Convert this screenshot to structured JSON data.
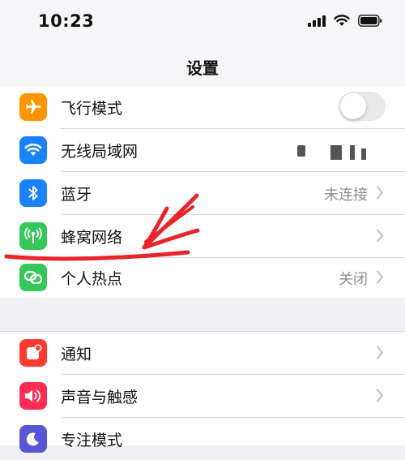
{
  "status_bar": {
    "time": "10:23",
    "icons": [
      "cellular-signal-icon",
      "wifi-icon",
      "battery-icon"
    ]
  },
  "nav": {
    "title": "设置"
  },
  "colors": {
    "airplane": "#ff9500",
    "wifi": "#1a82fb",
    "bluetooth": "#1a82fb",
    "cellular": "#34c759",
    "hotspot": "#34c759",
    "notifications": "#ff3b30",
    "sounds": "#ff2d55",
    "focus": "#5856d6",
    "annotation": "#e8252a"
  },
  "settings_group_1": [
    {
      "key": "airplane",
      "label": "飞行模式",
      "icon": "airplane-icon",
      "control": "toggle",
      "toggle_on": false
    },
    {
      "key": "wifi",
      "label": "无线局域网",
      "icon": "wifi-icon",
      "control": "value-redacted"
    },
    {
      "key": "bluetooth",
      "label": "蓝牙",
      "icon": "bluetooth-icon",
      "value": "未连接",
      "control": "chevron"
    },
    {
      "key": "cellular",
      "label": "蜂窝网络",
      "icon": "antenna-icon",
      "control": "chevron"
    },
    {
      "key": "hotspot",
      "label": "个人热点",
      "icon": "hotspot-link-icon",
      "value": "关闭",
      "control": "chevron"
    }
  ],
  "settings_group_2": [
    {
      "key": "notifications",
      "label": "通知",
      "icon": "notification-badge-icon",
      "control": "chevron"
    },
    {
      "key": "sounds",
      "label": "声音与触感",
      "icon": "speaker-icon",
      "control": "chevron"
    },
    {
      "key": "focus",
      "label": "专注模式",
      "icon": "moon-icon",
      "control": "chevron"
    }
  ]
}
